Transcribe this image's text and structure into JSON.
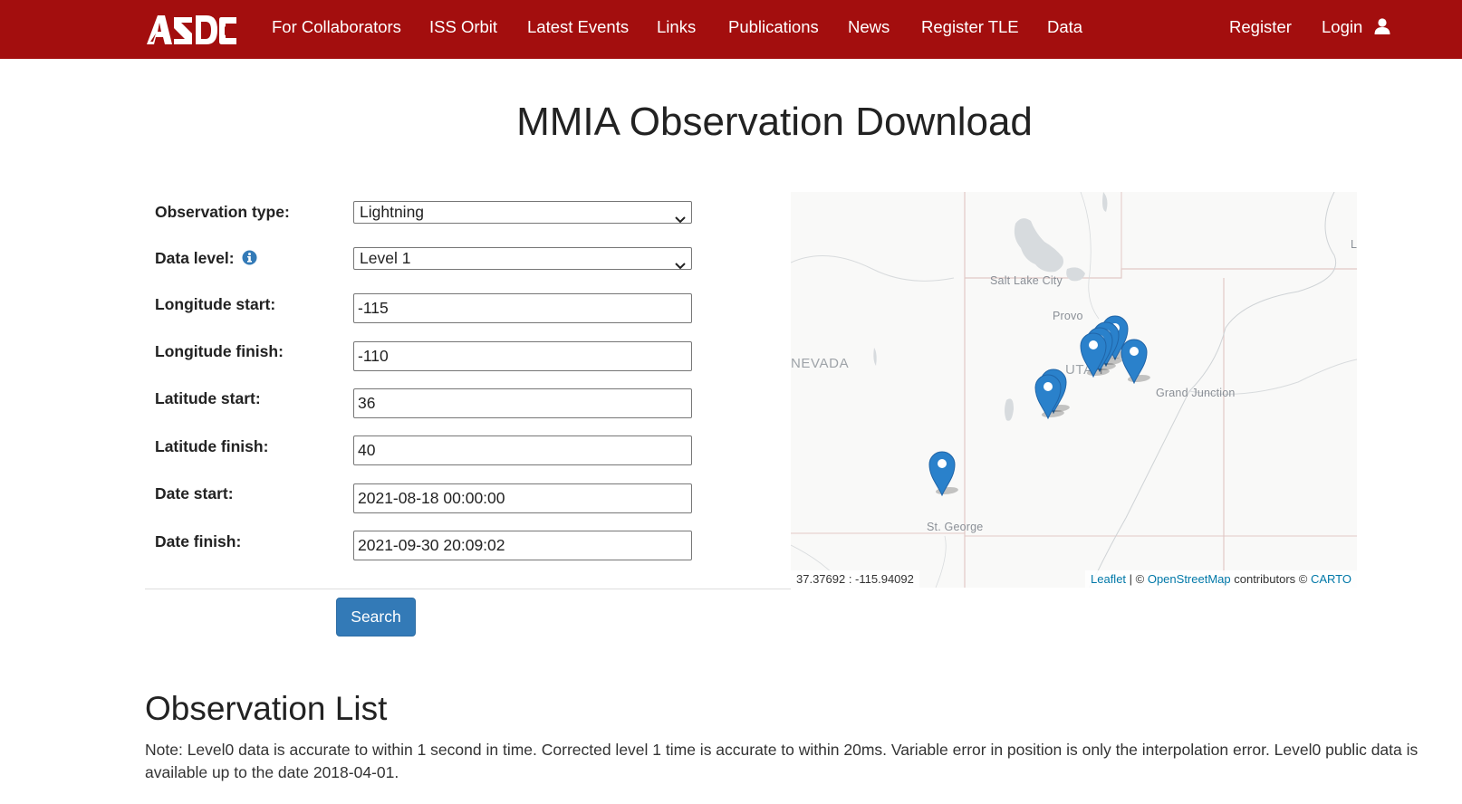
{
  "nav": {
    "logo_text": "ASDC",
    "links": [
      "For Collaborators",
      "ISS Orbit",
      "Latest Events",
      "Links",
      "Publications",
      "News",
      "Register TLE",
      "Data"
    ],
    "register": "Register",
    "login": "Login"
  },
  "page_title": "MMIA Observation Download",
  "form": {
    "observation_type": {
      "label": "Observation type:",
      "value": "Lightning"
    },
    "data_level": {
      "label": "Data level:",
      "value": "Level 1"
    },
    "longitude_start": {
      "label": "Longitude start:",
      "value": "-115"
    },
    "longitude_finish": {
      "label": "Longitude finish:",
      "value": "-110"
    },
    "latitude_start": {
      "label": "Latitude start:",
      "value": "36"
    },
    "latitude_finish": {
      "label": "Latitude finish:",
      "value": "40"
    },
    "date_start": {
      "label": "Date start:",
      "value": "2021-08-18 00:00:00"
    },
    "date_finish": {
      "label": "Date finish:",
      "value": "2021-09-30 20:09:02"
    },
    "search_label": "Search"
  },
  "map": {
    "labels": {
      "nevada": "NEVADA",
      "utah": "UTAH",
      "salt_lake_city": "Salt Lake City",
      "provo": "Provo",
      "grand_junction": "Grand Junction",
      "st_george": "St. George",
      "partial_edge": "L"
    },
    "coordinates": "37.37692 : -115.94092",
    "attribution": {
      "leaflet": "Leaflet",
      "sep1": " | © ",
      "osm": "OpenStreetMap",
      "contributors": " contributors © ",
      "carto": "CARTO"
    },
    "marker_color": "#2a81cb",
    "marker_count": 8
  },
  "observation_list": {
    "title": "Observation List",
    "note": "Note: Level0 data is accurate to within 1 second in time. Corrected level 1 time is accurate to within 20ms. Variable error in position is only the interpolation error. Level0 public data is available up to the date 2018-04-01."
  },
  "colors": {
    "navbar": "#a30e0e",
    "button": "#337ab7",
    "link": "#0078a8"
  }
}
